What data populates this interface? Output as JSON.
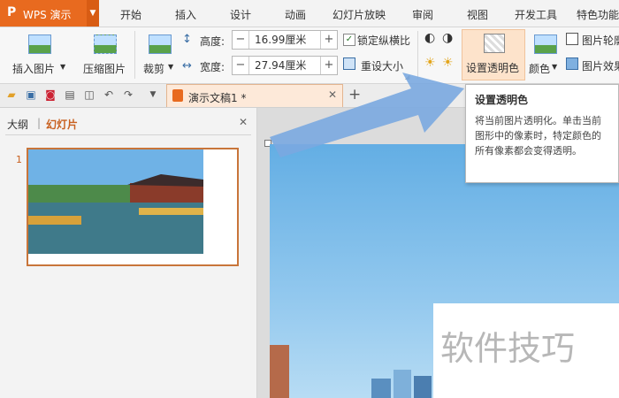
{
  "app": {
    "name": "WPS 演示",
    "logo": "P"
  },
  "menu": [
    "开始",
    "插入",
    "设计",
    "动画",
    "幻灯片放映",
    "审阅",
    "视图",
    "开发工具",
    "特色功能"
  ],
  "ribbon": {
    "insert_picture": "插入图片",
    "compress_picture": "压缩图片",
    "crop": "裁剪",
    "height_label": "高度:",
    "height_value": "16.99厘米",
    "width_label": "宽度:",
    "width_value": "27.94厘米",
    "lock_ratio": "锁定纵横比",
    "reset_size": "重设大小",
    "set_transparent": "设置透明色",
    "color": "颜色",
    "picture_outline": "图片轮廓",
    "picture_effect": "图片效果"
  },
  "document_tab": {
    "title": "演示文稿1 *"
  },
  "left_pane": {
    "tab_outline": "大纲",
    "tab_slides": "幻灯片",
    "slide_number": "1"
  },
  "tooltip": {
    "title": "设置透明色",
    "body": "将当前图片透明化。单击当前图形中的像素时，特定颜色的所有像素都会变得透明。"
  },
  "watermark": "软件技巧",
  "colors": {
    "brand_orange": "#e86a1f",
    "tab_bg": "#fde9d9",
    "thumb_border": "#c8753a",
    "sky": "#63aee4"
  }
}
